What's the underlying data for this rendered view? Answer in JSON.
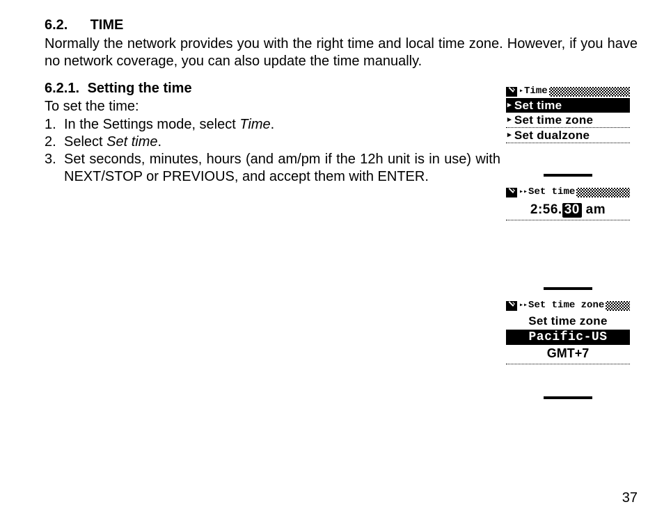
{
  "section": {
    "number": "6.2.",
    "title": "TIME",
    "intro": "Normally the network provides you with the right time and local time zone. However, if you have no network coverage, you can also update the time manually."
  },
  "subsection": {
    "number": "6.2.1.",
    "title": "Setting the time",
    "lead": "To set the time:",
    "steps": [
      {
        "prefix": "In the Settings mode, select ",
        "emph": "Time",
        "suffix": "."
      },
      {
        "prefix": "Select ",
        "emph": "Set time",
        "suffix": "."
      },
      {
        "full": "Set seconds, minutes, hours (and am/pm if the 12h unit is in use) with NEXT/STOP or PREVIOUS, and accept them with ENTER."
      }
    ]
  },
  "screens": {
    "time_menu": {
      "header": "Time",
      "items": [
        {
          "label": "Set time",
          "selected": true
        },
        {
          "label": "Set time zone",
          "selected": false
        },
        {
          "label": "Set dualzone",
          "selected": false
        }
      ]
    },
    "set_time": {
      "header": "Set time",
      "hours_minutes": "2:56.",
      "seconds_selected": "30",
      "ampm": " am"
    },
    "set_timezone": {
      "header": "Set time zone",
      "title": "Set time zone",
      "selected": "Pacific-US",
      "below": "GMT+7"
    }
  },
  "page_number": "37"
}
